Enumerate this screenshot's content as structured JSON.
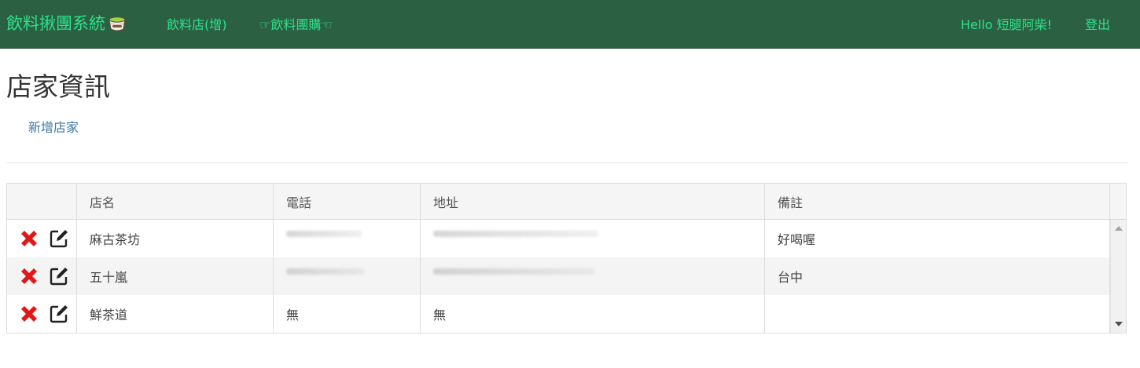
{
  "navbar": {
    "brand": "飲料揪團系統",
    "brand_icon": "bubble-tea-cup-icon",
    "links": [
      {
        "label": "飲料店(增)"
      },
      {
        "label": "☞飲料團購☜"
      }
    ],
    "greeting": "Hello 短腿阿柴!",
    "logout": "登出"
  },
  "page": {
    "title": "店家資訊",
    "add_link": "新增店家"
  },
  "table": {
    "columns": [
      "",
      "店名",
      "電話",
      "地址",
      "備註"
    ],
    "rows": [
      {
        "name": "麻古茶坊",
        "phone": "",
        "address": "",
        "note": "好喝喔",
        "phone_redacted": true,
        "address_redacted": true
      },
      {
        "name": "五十嵐",
        "phone": "",
        "address": "",
        "note": "台中",
        "phone_redacted": true,
        "address_redacted": true
      },
      {
        "name": "鮮茶道",
        "phone": "無",
        "address": "無",
        "note": ""
      }
    ],
    "row_icons": [
      "delete-icon",
      "edit-icon"
    ]
  },
  "colors": {
    "navbar_bg": "#2b6142",
    "nav_text": "#2fe08e",
    "link": "#3c7aa6",
    "delete_red": "#e01818"
  }
}
